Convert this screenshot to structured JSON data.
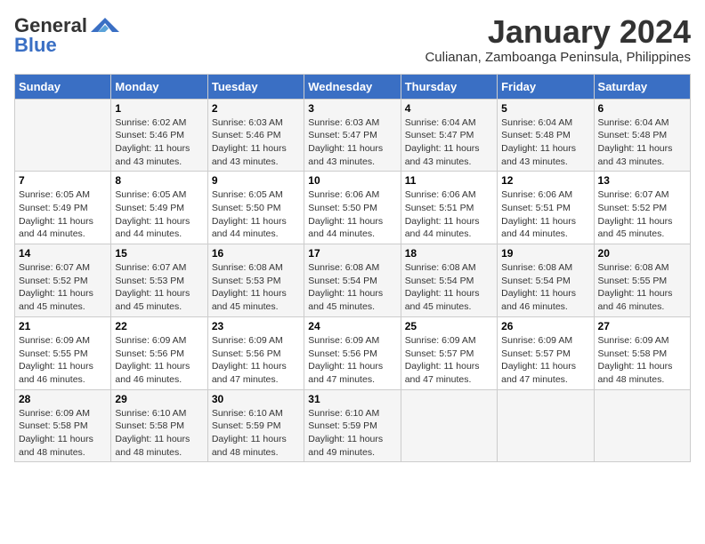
{
  "header": {
    "logo_line1": "General",
    "logo_line2": "Blue",
    "title": "January 2024",
    "subtitle": "Culianan, Zamboanga Peninsula, Philippines"
  },
  "weekdays": [
    "Sunday",
    "Monday",
    "Tuesday",
    "Wednesday",
    "Thursday",
    "Friday",
    "Saturday"
  ],
  "weeks": [
    [
      {
        "day": "",
        "sunrise": "",
        "sunset": "",
        "daylight": ""
      },
      {
        "day": "1",
        "sunrise": "Sunrise: 6:02 AM",
        "sunset": "Sunset: 5:46 PM",
        "daylight": "Daylight: 11 hours and 43 minutes."
      },
      {
        "day": "2",
        "sunrise": "Sunrise: 6:03 AM",
        "sunset": "Sunset: 5:46 PM",
        "daylight": "Daylight: 11 hours and 43 minutes."
      },
      {
        "day": "3",
        "sunrise": "Sunrise: 6:03 AM",
        "sunset": "Sunset: 5:47 PM",
        "daylight": "Daylight: 11 hours and 43 minutes."
      },
      {
        "day": "4",
        "sunrise": "Sunrise: 6:04 AM",
        "sunset": "Sunset: 5:47 PM",
        "daylight": "Daylight: 11 hours and 43 minutes."
      },
      {
        "day": "5",
        "sunrise": "Sunrise: 6:04 AM",
        "sunset": "Sunset: 5:48 PM",
        "daylight": "Daylight: 11 hours and 43 minutes."
      },
      {
        "day": "6",
        "sunrise": "Sunrise: 6:04 AM",
        "sunset": "Sunset: 5:48 PM",
        "daylight": "Daylight: 11 hours and 43 minutes."
      }
    ],
    [
      {
        "day": "7",
        "sunrise": "Sunrise: 6:05 AM",
        "sunset": "Sunset: 5:49 PM",
        "daylight": "Daylight: 11 hours and 44 minutes."
      },
      {
        "day": "8",
        "sunrise": "Sunrise: 6:05 AM",
        "sunset": "Sunset: 5:49 PM",
        "daylight": "Daylight: 11 hours and 44 minutes."
      },
      {
        "day": "9",
        "sunrise": "Sunrise: 6:05 AM",
        "sunset": "Sunset: 5:50 PM",
        "daylight": "Daylight: 11 hours and 44 minutes."
      },
      {
        "day": "10",
        "sunrise": "Sunrise: 6:06 AM",
        "sunset": "Sunset: 5:50 PM",
        "daylight": "Daylight: 11 hours and 44 minutes."
      },
      {
        "day": "11",
        "sunrise": "Sunrise: 6:06 AM",
        "sunset": "Sunset: 5:51 PM",
        "daylight": "Daylight: 11 hours and 44 minutes."
      },
      {
        "day": "12",
        "sunrise": "Sunrise: 6:06 AM",
        "sunset": "Sunset: 5:51 PM",
        "daylight": "Daylight: 11 hours and 44 minutes."
      },
      {
        "day": "13",
        "sunrise": "Sunrise: 6:07 AM",
        "sunset": "Sunset: 5:52 PM",
        "daylight": "Daylight: 11 hours and 45 minutes."
      }
    ],
    [
      {
        "day": "14",
        "sunrise": "Sunrise: 6:07 AM",
        "sunset": "Sunset: 5:52 PM",
        "daylight": "Daylight: 11 hours and 45 minutes."
      },
      {
        "day": "15",
        "sunrise": "Sunrise: 6:07 AM",
        "sunset": "Sunset: 5:53 PM",
        "daylight": "Daylight: 11 hours and 45 minutes."
      },
      {
        "day": "16",
        "sunrise": "Sunrise: 6:08 AM",
        "sunset": "Sunset: 5:53 PM",
        "daylight": "Daylight: 11 hours and 45 minutes."
      },
      {
        "day": "17",
        "sunrise": "Sunrise: 6:08 AM",
        "sunset": "Sunset: 5:54 PM",
        "daylight": "Daylight: 11 hours and 45 minutes."
      },
      {
        "day": "18",
        "sunrise": "Sunrise: 6:08 AM",
        "sunset": "Sunset: 5:54 PM",
        "daylight": "Daylight: 11 hours and 45 minutes."
      },
      {
        "day": "19",
        "sunrise": "Sunrise: 6:08 AM",
        "sunset": "Sunset: 5:54 PM",
        "daylight": "Daylight: 11 hours and 46 minutes."
      },
      {
        "day": "20",
        "sunrise": "Sunrise: 6:08 AM",
        "sunset": "Sunset: 5:55 PM",
        "daylight": "Daylight: 11 hours and 46 minutes."
      }
    ],
    [
      {
        "day": "21",
        "sunrise": "Sunrise: 6:09 AM",
        "sunset": "Sunset: 5:55 PM",
        "daylight": "Daylight: 11 hours and 46 minutes."
      },
      {
        "day": "22",
        "sunrise": "Sunrise: 6:09 AM",
        "sunset": "Sunset: 5:56 PM",
        "daylight": "Daylight: 11 hours and 46 minutes."
      },
      {
        "day": "23",
        "sunrise": "Sunrise: 6:09 AM",
        "sunset": "Sunset: 5:56 PM",
        "daylight": "Daylight: 11 hours and 47 minutes."
      },
      {
        "day": "24",
        "sunrise": "Sunrise: 6:09 AM",
        "sunset": "Sunset: 5:56 PM",
        "daylight": "Daylight: 11 hours and 47 minutes."
      },
      {
        "day": "25",
        "sunrise": "Sunrise: 6:09 AM",
        "sunset": "Sunset: 5:57 PM",
        "daylight": "Daylight: 11 hours and 47 minutes."
      },
      {
        "day": "26",
        "sunrise": "Sunrise: 6:09 AM",
        "sunset": "Sunset: 5:57 PM",
        "daylight": "Daylight: 11 hours and 47 minutes."
      },
      {
        "day": "27",
        "sunrise": "Sunrise: 6:09 AM",
        "sunset": "Sunset: 5:58 PM",
        "daylight": "Daylight: 11 hours and 48 minutes."
      }
    ],
    [
      {
        "day": "28",
        "sunrise": "Sunrise: 6:09 AM",
        "sunset": "Sunset: 5:58 PM",
        "daylight": "Daylight: 11 hours and 48 minutes."
      },
      {
        "day": "29",
        "sunrise": "Sunrise: 6:10 AM",
        "sunset": "Sunset: 5:58 PM",
        "daylight": "Daylight: 11 hours and 48 minutes."
      },
      {
        "day": "30",
        "sunrise": "Sunrise: 6:10 AM",
        "sunset": "Sunset: 5:59 PM",
        "daylight": "Daylight: 11 hours and 48 minutes."
      },
      {
        "day": "31",
        "sunrise": "Sunrise: 6:10 AM",
        "sunset": "Sunset: 5:59 PM",
        "daylight": "Daylight: 11 hours and 49 minutes."
      },
      {
        "day": "",
        "sunrise": "",
        "sunset": "",
        "daylight": ""
      },
      {
        "day": "",
        "sunrise": "",
        "sunset": "",
        "daylight": ""
      },
      {
        "day": "",
        "sunrise": "",
        "sunset": "",
        "daylight": ""
      }
    ]
  ]
}
